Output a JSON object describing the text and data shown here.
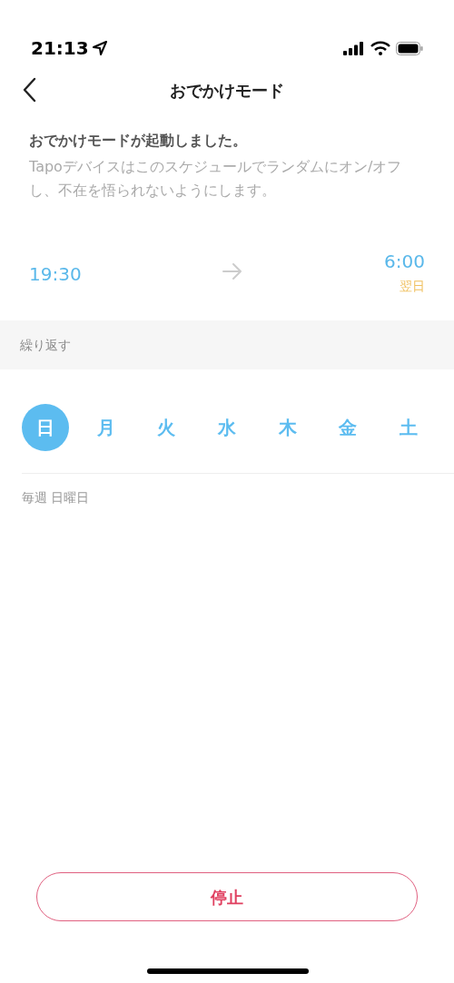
{
  "status_bar": {
    "time": "21:13"
  },
  "nav": {
    "title": "おでかけモード"
  },
  "notice": {
    "heading": "おでかけモードが起動しました。",
    "body": "Tapoデバイスはこのスケジュールでランダムにオン/オフし、不在を悟られないようにします。"
  },
  "schedule": {
    "start": "19:30",
    "end": "6:00",
    "end_note": "翌日"
  },
  "repeat": {
    "label": "繰り返す",
    "days": [
      {
        "label": "日",
        "selected": true
      },
      {
        "label": "月",
        "selected": false
      },
      {
        "label": "火",
        "selected": false
      },
      {
        "label": "水",
        "selected": false
      },
      {
        "label": "木",
        "selected": false
      },
      {
        "label": "金",
        "selected": false
      },
      {
        "label": "土",
        "selected": false
      }
    ],
    "summary": "毎週 日曜日"
  },
  "stop_button": "停止"
}
